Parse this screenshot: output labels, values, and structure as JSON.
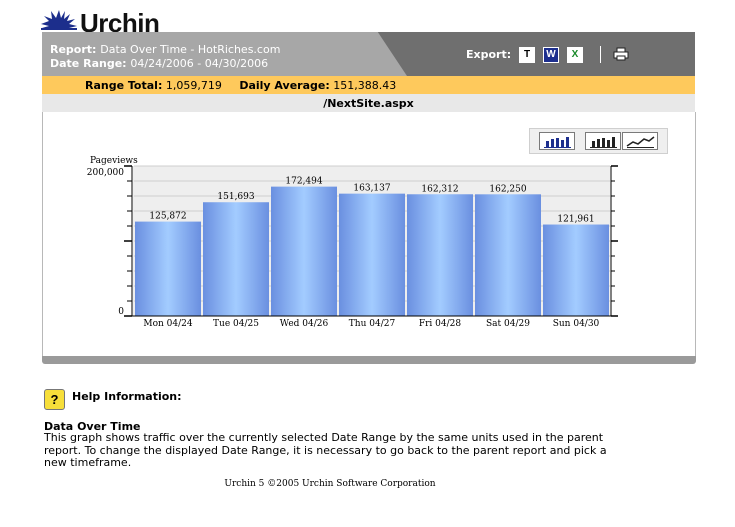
{
  "brand": {
    "logo_text": "Urchin"
  },
  "header": {
    "report_label": "Report:",
    "report_value": "Data Over Time - HotRiches.com",
    "date_label": "Date Range:",
    "date_value": "04/24/2006 - 04/30/2006",
    "export_label": "Export:",
    "export_icons": [
      "T",
      "W",
      "X"
    ],
    "print_icon": "printer-icon"
  },
  "range": {
    "total_label": "Range Total:",
    "total_value": "1,059,719",
    "avg_label": "Daily Average:",
    "avg_value": "151,388.43"
  },
  "page_title": "/NextSite.aspx",
  "chart_buttons": [
    "bar-chart-icon",
    "bar-chart-icon",
    "line-chart-icon"
  ],
  "chart_data": {
    "type": "bar",
    "ylabel": "Pageviews",
    "ytick_labels": [
      "200,000",
      "0"
    ],
    "ylim": [
      0,
      200000
    ],
    "categories": [
      "Mon 04/24",
      "Tue 04/25",
      "Wed 04/26",
      "Thu 04/27",
      "Fri 04/28",
      "Sat 04/29",
      "Sun 04/30"
    ],
    "values": [
      125872,
      151693,
      172494,
      163137,
      162312,
      162250,
      121961
    ],
    "value_labels": [
      "125,872",
      "151,693",
      "172,494",
      "163,137",
      "162,312",
      "162,250",
      "121,961"
    ],
    "grid": true,
    "colors": {
      "bar_edge": "#6a8fe0",
      "bar_center": "#9fc8ff",
      "plot_bg": "#eeeeee"
    }
  },
  "help": {
    "icon": "?",
    "title": "Help Information:",
    "heading": "Data Over Time",
    "body": "This graph shows traffic over the currently selected Date Range by the same units used in the parent report. To change the displayed Date Range, it is necessary to go back to the parent report and pick a new timeframe."
  },
  "footer": "Urchin 5 ©2005 Urchin Software Corporation",
  "colors": {
    "header_dark": "#6f6f6f",
    "header_light": "#a7a7a7",
    "range_bar": "#fec95c"
  }
}
